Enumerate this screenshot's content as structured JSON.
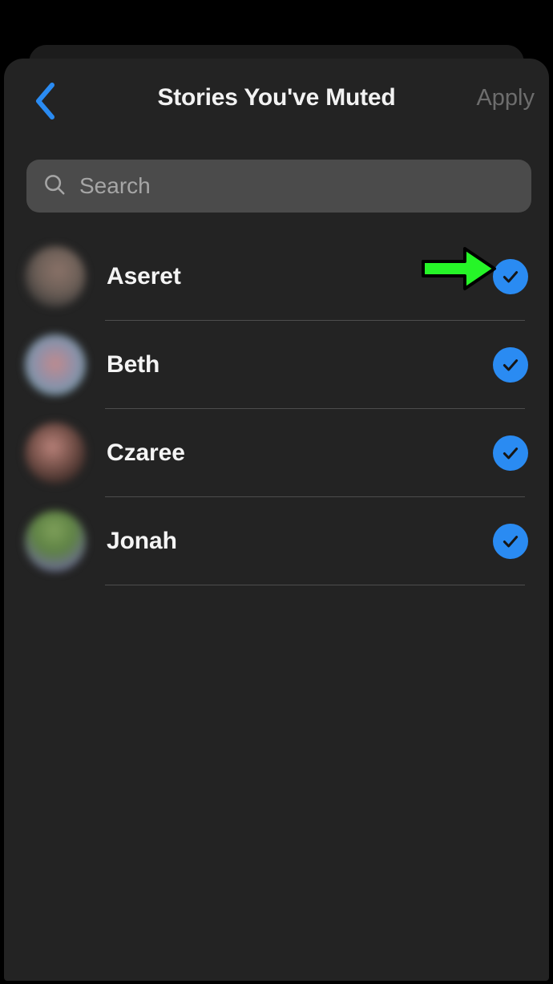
{
  "header": {
    "title": "Stories You've Muted",
    "back_icon": "chevron-left-icon",
    "apply_label": "Apply"
  },
  "search": {
    "icon": "search-icon",
    "placeholder": "Search",
    "value": ""
  },
  "list": {
    "items": [
      {
        "name": "Aseret",
        "checked": true,
        "check_icon": "checkmark-circle-icon",
        "avatar": "avatar-image"
      },
      {
        "name": "Beth",
        "checked": true,
        "check_icon": "checkmark-circle-icon",
        "avatar": "avatar-image"
      },
      {
        "name": "Czaree",
        "checked": true,
        "check_icon": "checkmark-circle-icon",
        "avatar": "avatar-image"
      },
      {
        "name": "Jonah",
        "checked": true,
        "check_icon": "checkmark-circle-icon",
        "avatar": "avatar-image"
      }
    ]
  },
  "annotation": {
    "icon": "green-arrow-right-icon",
    "points_at": "Aseret",
    "color": "#26F528",
    "outline_color": "#000000"
  },
  "colors": {
    "background": "#000000",
    "panel": "#232323",
    "back_card": "#1c1c1c",
    "accent_blue": "#2a8bf2",
    "back_chevron": "#2a8bf2",
    "apply_disabled": "#6d6d6d",
    "search_field": "#4b4b4b",
    "search_placeholder": "#a6a6a6",
    "text_primary": "#f4f4f4",
    "divider": "#4d4d4d"
  }
}
